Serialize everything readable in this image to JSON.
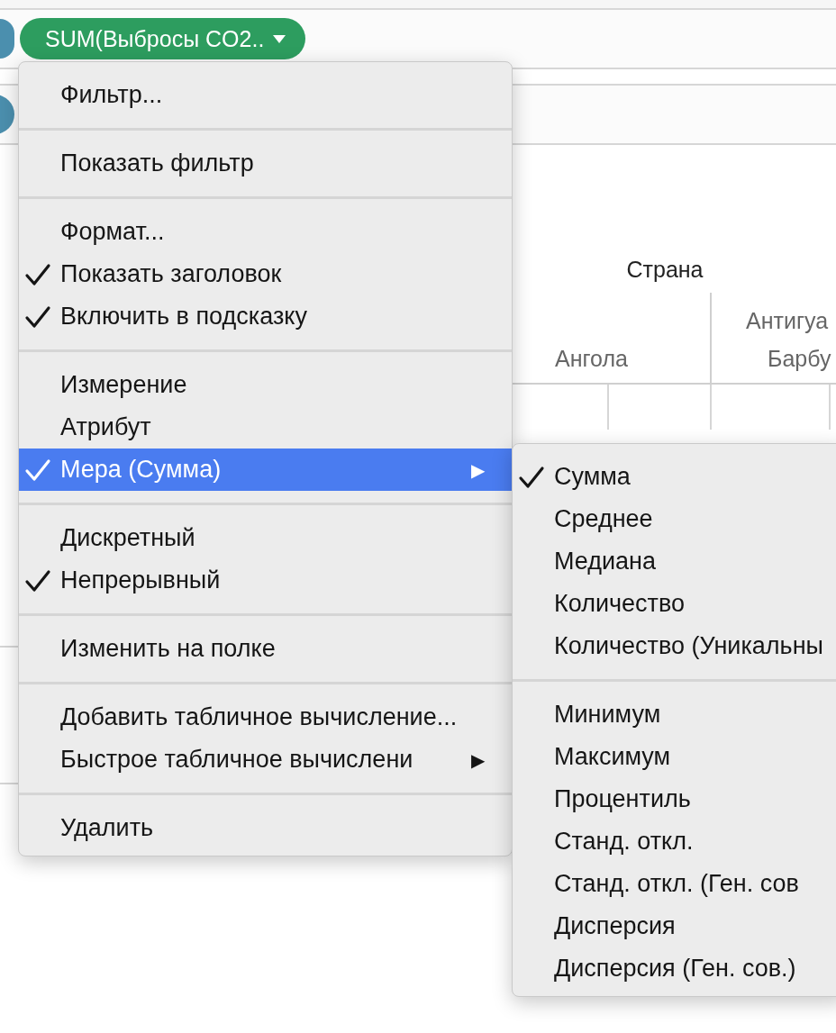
{
  "shelf": {
    "pill": {
      "label": "SUM(Выбросы CO2.."
    }
  },
  "view": {
    "header": "Страна",
    "columns": [
      {
        "lines": [
          "Ангола"
        ]
      },
      {
        "lines": [
          "Антигуа",
          "Барбу"
        ]
      }
    ]
  },
  "context_menu": {
    "items": [
      {
        "kind": "item",
        "label": "Фильтр...",
        "checked": false,
        "selected": false
      },
      {
        "kind": "separator"
      },
      {
        "kind": "item",
        "label": "Показать фильтр",
        "checked": false,
        "selected": false
      },
      {
        "kind": "separator"
      },
      {
        "kind": "item",
        "label": "Формат...",
        "checked": false,
        "selected": false
      },
      {
        "kind": "item",
        "label": "Показать заголовок",
        "checked": true,
        "selected": false
      },
      {
        "kind": "item",
        "label": "Включить в подсказку",
        "checked": true,
        "selected": false
      },
      {
        "kind": "separator"
      },
      {
        "kind": "item",
        "label": "Измерение",
        "checked": false,
        "selected": false
      },
      {
        "kind": "item",
        "label": "Атрибут",
        "checked": false,
        "selected": false
      },
      {
        "kind": "item",
        "label": "Мера (Сумма)",
        "checked": true,
        "selected": true,
        "arrow": "▶"
      },
      {
        "kind": "separator"
      },
      {
        "kind": "item",
        "label": "Дискретный",
        "checked": false,
        "selected": false
      },
      {
        "kind": "item",
        "label": "Непрерывный",
        "checked": true,
        "selected": false
      },
      {
        "kind": "separator"
      },
      {
        "kind": "item",
        "label": "Изменить на полке",
        "checked": false,
        "selected": false
      },
      {
        "kind": "separator"
      },
      {
        "kind": "item",
        "label": "Добавить табличное вычисление...",
        "checked": false,
        "selected": false
      },
      {
        "kind": "item",
        "label": "Быстрое табличное вычислени",
        "checked": false,
        "selected": false,
        "arrow": "▶"
      },
      {
        "kind": "separator"
      },
      {
        "kind": "item",
        "label": "Удалить",
        "checked": false,
        "selected": false
      }
    ]
  },
  "submenu": {
    "items": [
      {
        "kind": "item",
        "label": "Сумма",
        "checked": true,
        "selected": false
      },
      {
        "kind": "item",
        "label": "Среднее",
        "checked": false,
        "selected": false
      },
      {
        "kind": "item",
        "label": "Медиана",
        "checked": false,
        "selected": false
      },
      {
        "kind": "item",
        "label": "Количество",
        "checked": false,
        "selected": false
      },
      {
        "kind": "item",
        "label": "Количество (Уникальны",
        "checked": false,
        "selected": false
      },
      {
        "kind": "separator"
      },
      {
        "kind": "item",
        "label": "Минимум",
        "checked": false,
        "selected": false
      },
      {
        "kind": "item",
        "label": "Максимум",
        "checked": false,
        "selected": false
      },
      {
        "kind": "item",
        "label": "Процентиль",
        "checked": false,
        "selected": false
      },
      {
        "kind": "item",
        "label": "Станд. откл.",
        "checked": false,
        "selected": false
      },
      {
        "kind": "item",
        "label": "Станд. откл. (Ген. сов",
        "checked": false,
        "selected": false
      },
      {
        "kind": "item",
        "label": "Дисперсия",
        "checked": false,
        "selected": false
      },
      {
        "kind": "item",
        "label": "Дисперсия (Ген. сов.)",
        "checked": false,
        "selected": false
      }
    ]
  }
}
